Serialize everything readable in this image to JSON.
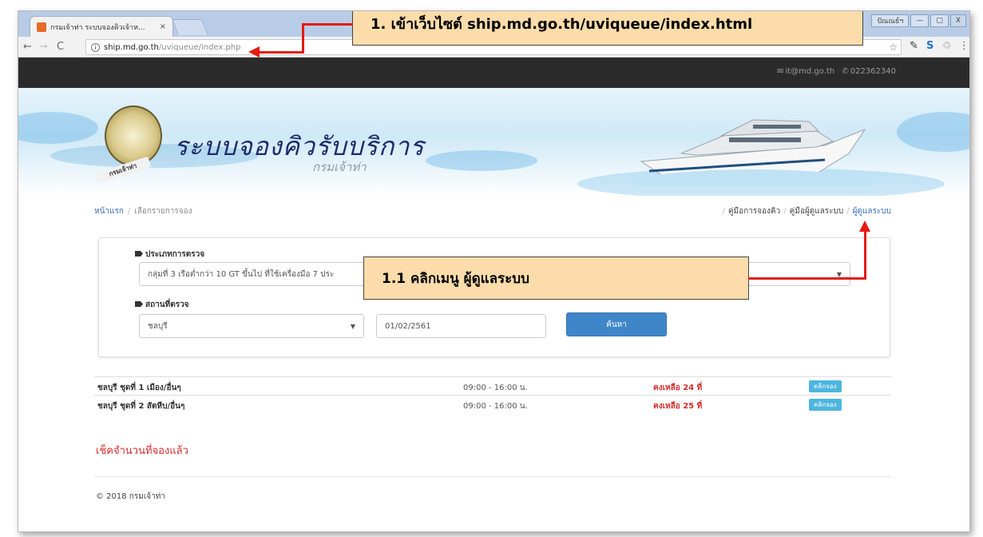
{
  "browser": {
    "tab_title": "กรมเจ้าท่า ระบบจองคิวเจ้าห...",
    "tab_close": "×",
    "url_host": "ship.md.go.th",
    "url_path": "/uviqueue/index.php",
    "window_buttons": {
      "user": "ปัณณธ์ฯ",
      "minimize": "—",
      "maximize": "▢",
      "close": "X"
    }
  },
  "topbar": {
    "email": "it@md.go.th",
    "phone": "022362340"
  },
  "banner": {
    "title": "ระบบจองคิวรับบริการ",
    "subtitle": "กรมเจ้าท่า",
    "seal_label": "กรมเจ้าท่า"
  },
  "breadcrumb": {
    "home": "หน้าแรก",
    "current": "เลือกรายการจอง"
  },
  "toplinks": {
    "booking_manual": "คู่มือการจองคิว",
    "admin_manual": "คู่มือผู้ดูแลระบบ",
    "admin": "ผู้ดูแลระบบ"
  },
  "search": {
    "type_label": "ประเภทการตรวจ",
    "type_value": "กลุ่มที่ 3 เรือต่ำกว่า 10 GT ขึ้นไป ที่ใช้เครื่องมือ 7 ประ",
    "place_label": "สถานที่ตรวจ",
    "place_value": "ชลบุรี",
    "date_value": "01/02/2561",
    "search_button": "ค้นหา"
  },
  "results": [
    {
      "name": "ชลบุรี ชุดที่ 1 เมือง/อื่นๆ",
      "time": "09:00 - 16:00 น.",
      "remaining": "คงเหลือ 24 ที่",
      "action": "คลิกจอง"
    },
    {
      "name": "ชลบุรี ชุดที่ 2 สัตหีบ/อื่นๆ",
      "time": "09:00 - 16:00 น.",
      "remaining": "คงเหลือ 25 ที่",
      "action": "คลิกจอง"
    }
  ],
  "check_link": "เช็คจำนวนที่จองแล้ว",
  "footer": "© 2018 กรมเจ้าท่า",
  "annotations": {
    "step1": "1. เข้าเว็บไซต์ ship.md.go.th/uviqueue/index.html",
    "step1_1": "1.1 คลิกเมนู ผู้ดูแลระบบ"
  },
  "colors": {
    "accent_red": "#e51b12",
    "callout_bg": "#fbdcaa",
    "link_blue": "#3a6bb8",
    "button_blue": "#3f86c9"
  }
}
